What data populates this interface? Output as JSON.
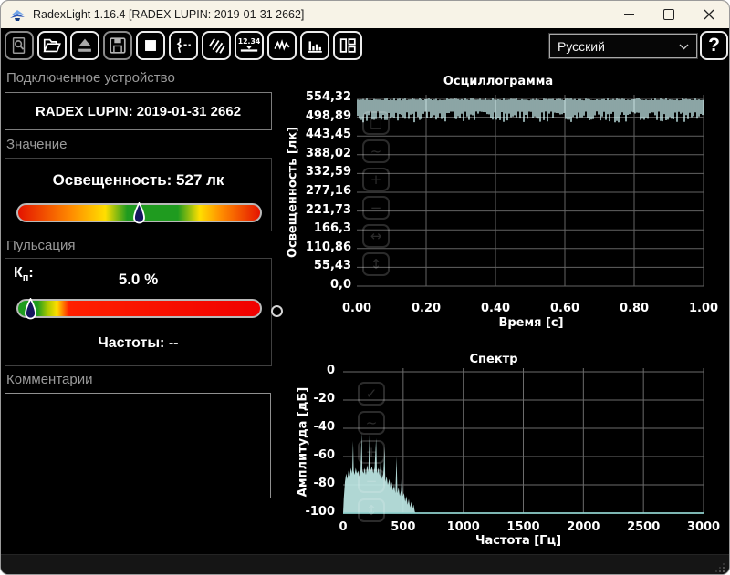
{
  "window": {
    "title": "RadexLight 1.16.4 [RADEX LUPIN: 2019-01-31 2662]"
  },
  "toolbar": {
    "buttons": [
      {
        "name": "preview-search",
        "disabled": true
      },
      {
        "name": "open-file",
        "disabled": false
      },
      {
        "name": "eject-device",
        "disabled": true
      },
      {
        "name": "save-file",
        "disabled": true
      },
      {
        "name": "stop-measurement",
        "disabled": false
      },
      {
        "name": "measurement-marker",
        "disabled": false
      },
      {
        "name": "light-rays",
        "disabled": false
      },
      {
        "name": "numeric-display",
        "label": "12.34",
        "disabled": false
      },
      {
        "name": "oscillogram-view",
        "disabled": false
      },
      {
        "name": "spectrum-view",
        "disabled": false
      },
      {
        "name": "layout-panels",
        "disabled": false
      }
    ],
    "language": {
      "value": "Русский"
    },
    "help_label": "?"
  },
  "left_panel": {
    "device_section": {
      "header": "Подключенное устройство",
      "device_name": "RADEX LUPIN: 2019-01-31 2662"
    },
    "value_section": {
      "header": "Значение",
      "value_label": "Освещенность: 527 лк",
      "marker_position_pct": 50,
      "bar_gradient": [
        "#e41400",
        "#ff8c00",
        "#ffdf00",
        "#1f9b1f",
        "#1f9b1f",
        "#ffdf00",
        "#ff8c00",
        "#e41400"
      ]
    },
    "pulsation_section": {
      "header": "Пульсация",
      "kp_letter": "К",
      "kp_sub": "п",
      "kp_suffix": ":",
      "kp_value": "5.0 %",
      "freq_label": "Частоты: --",
      "marker_position_pct": 5,
      "bar_gradient": [
        "#1f9b1f",
        "#a5c800",
        "#ffdf00",
        "#ff2000",
        "#f00000"
      ]
    },
    "comments_section": {
      "header": "Комментарии",
      "text": ""
    }
  },
  "chart_overlays": {
    "oscillogram": [
      {
        "name": "region-select",
        "glyph": "□"
      },
      {
        "name": "autoscale",
        "glyph": "~"
      },
      {
        "name": "zoom-in",
        "glyph": "+"
      },
      {
        "name": "zoom-out",
        "glyph": "−"
      },
      {
        "name": "fit-width",
        "glyph": "↔"
      },
      {
        "name": "fit-height",
        "glyph": "↕"
      }
    ],
    "spectrum": [
      {
        "name": "apply",
        "glyph": "✓"
      },
      {
        "name": "autoscale",
        "glyph": "~"
      },
      {
        "name": "zoom-in",
        "glyph": "+"
      },
      {
        "name": "zoom-out",
        "glyph": "−"
      },
      {
        "name": "fit-height",
        "glyph": "↕"
      }
    ]
  },
  "chart_data": [
    {
      "type": "line",
      "title": "Осциллограмма",
      "xlabel": "Время [с]",
      "ylabel": "Освещенность [лк]",
      "x_ticks": [
        "0.00",
        "0.20",
        "0.40",
        "0.60",
        "0.80",
        "1.00"
      ],
      "y_ticks": [
        "554,32",
        "498,89",
        "443,45",
        "388,02",
        "332,59",
        "277,16",
        "221,73",
        "166,3",
        "110,86",
        "55,43",
        "0,0"
      ],
      "xlim": [
        0,
        1
      ],
      "ylim": [
        0,
        554.32
      ],
      "grid": true,
      "series": [
        {
          "name": "Освещенность",
          "color": "#c7ecec",
          "waveform_max_lx": 554,
          "waveform_typical_min_lx": 505,
          "waveform_envelope_min_lx": 489,
          "mean_lx": 527,
          "description": "плотный шумовой сигнал, колебания между ~490 и ~554 лк на всём интервале 0–1 с"
        }
      ]
    },
    {
      "type": "area",
      "title": "Спектр",
      "xlabel": "Частота [Гц]",
      "ylabel": "Амплитуда [дБ]",
      "x_ticks": [
        "0",
        "500",
        "1000",
        "1500",
        "2000",
        "2500",
        "3000"
      ],
      "y_ticks": [
        "0",
        "-20",
        "-40",
        "-60",
        "-80",
        "-100"
      ],
      "xlim": [
        0,
        3000
      ],
      "ylim": [
        -100,
        0
      ],
      "grid": true,
      "series": [
        {
          "name": "Амплитуда",
          "color": "#bfe9e6",
          "noise_floor_db": -100,
          "flat_from_hz": 605,
          "outline_points": [
            [
              0,
              -100
            ],
            [
              5,
              -90
            ],
            [
              15,
              -78
            ],
            [
              25,
              -72
            ],
            [
              35,
              -76
            ],
            [
              45,
              -70
            ],
            [
              55,
              -74
            ],
            [
              65,
              -68
            ],
            [
              75,
              -72
            ],
            [
              83,
              -49
            ],
            [
              88,
              -70
            ],
            [
              95,
              -73
            ],
            [
              105,
              -68
            ],
            [
              115,
              -72
            ],
            [
              125,
              -70
            ],
            [
              135,
              -74
            ],
            [
              145,
              -70
            ],
            [
              155,
              -43
            ],
            [
              160,
              -70
            ],
            [
              170,
              -72
            ],
            [
              180,
              -68
            ],
            [
              190,
              -73
            ],
            [
              200,
              -66
            ],
            [
              210,
              -71
            ],
            [
              220,
              -44
            ],
            [
              228,
              -70
            ],
            [
              240,
              -67
            ],
            [
              252,
              -72
            ],
            [
              262,
              -68
            ],
            [
              275,
              -47
            ],
            [
              282,
              -72
            ],
            [
              295,
              -68
            ],
            [
              305,
              -74
            ],
            [
              315,
              -57
            ],
            [
              322,
              -76
            ],
            [
              335,
              -72
            ],
            [
              345,
              -53
            ],
            [
              352,
              -78
            ],
            [
              362,
              -74
            ],
            [
              372,
              -80
            ],
            [
              385,
              -76
            ],
            [
              395,
              -82
            ],
            [
              405,
              -78
            ],
            [
              415,
              -84
            ],
            [
              425,
              -80
            ],
            [
              435,
              -86
            ],
            [
              445,
              -60
            ],
            [
              452,
              -86
            ],
            [
              462,
              -82
            ],
            [
              472,
              -88
            ],
            [
              482,
              -84
            ],
            [
              490,
              -68
            ],
            [
              497,
              -88
            ],
            [
              507,
              -86
            ],
            [
              517,
              -92
            ],
            [
              527,
              -88
            ],
            [
              537,
              -94
            ],
            [
              547,
              -90
            ],
            [
              557,
              -96
            ],
            [
              567,
              -92
            ],
            [
              577,
              -97
            ],
            [
              587,
              -94
            ],
            [
              597,
              -99
            ],
            [
              605,
              -100
            ]
          ]
        }
      ]
    }
  ]
}
